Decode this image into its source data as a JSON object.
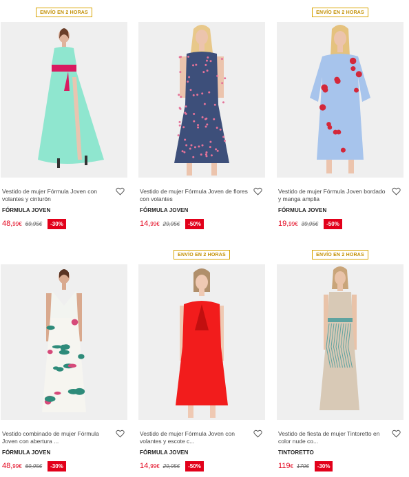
{
  "products": [
    {
      "badge": "ENVÍO EN 2 HORAS",
      "title": "Vestido de mujer Fórmula Joven con volantes y cinturón",
      "brand": "FÓRMULA JOVEN",
      "price_int": "48,",
      "price_dec": "99€",
      "old_price": "69,95€",
      "discount": "-30%",
      "dress_color": "#8fe6cf",
      "accent_color": "#d81b60",
      "print": "none"
    },
    {
      "badge": "",
      "title": "Vestido de mujer Fórmula Joven de flores con volantes",
      "brand": "FÓRMULA JOVEN",
      "price_int": "14,",
      "price_dec": "99€",
      "old_price": "29,95€",
      "discount": "-50%",
      "dress_color": "#3d4f7a",
      "accent_color": "#e57399",
      "print": "dots"
    },
    {
      "badge": "ENVÍO EN 2 HORAS",
      "title": "Vestido de mujer Fórmula Joven bordado y manga amplia",
      "brand": "FÓRMULA JOVEN",
      "price_int": "19,",
      "price_dec": "99€",
      "old_price": "39,95€",
      "discount": "-50%",
      "dress_color": "#a7c4ec",
      "accent_color": "#d3283a",
      "print": "flowers"
    },
    {
      "badge": "",
      "title": "Vestido combinado de mujer Fórmula Joven con abertura ...",
      "brand": "FÓRMULA JOVEN",
      "price_int": "48,",
      "price_dec": "99€",
      "old_price": "69,95€",
      "discount": "-30%",
      "dress_color": "#f2f4f0",
      "accent_color": "#2e8b7a",
      "print": "tropical"
    },
    {
      "badge": "ENVÍO EN 2 HORAS",
      "title": "Vestido de mujer Fórmula Joven con volantes y escote c...",
      "brand": "FÓRMULA JOVEN",
      "price_int": "14,",
      "price_dec": "99€",
      "old_price": "29,95€",
      "discount": "-50%",
      "dress_color": "#f21c1c",
      "accent_color": "#c20f0f",
      "print": "none"
    },
    {
      "badge": "ENVÍO EN 2 HORAS",
      "title": "Vestido de fiesta de mujer Tintoretto en color nude co...",
      "brand": "TINTORETTO",
      "price_int": "119",
      "price_dec": "€",
      "old_price": "170€",
      "discount": "-30%",
      "dress_color": "#d8c9b6",
      "accent_color": "#5fa3a0",
      "print": "beaded"
    }
  ],
  "colors": {
    "price": "#e2001a",
    "badge_border": "#d9a400",
    "image_bg": "#efefef"
  },
  "icons": {
    "wishlist": "heart-outline-icon"
  }
}
